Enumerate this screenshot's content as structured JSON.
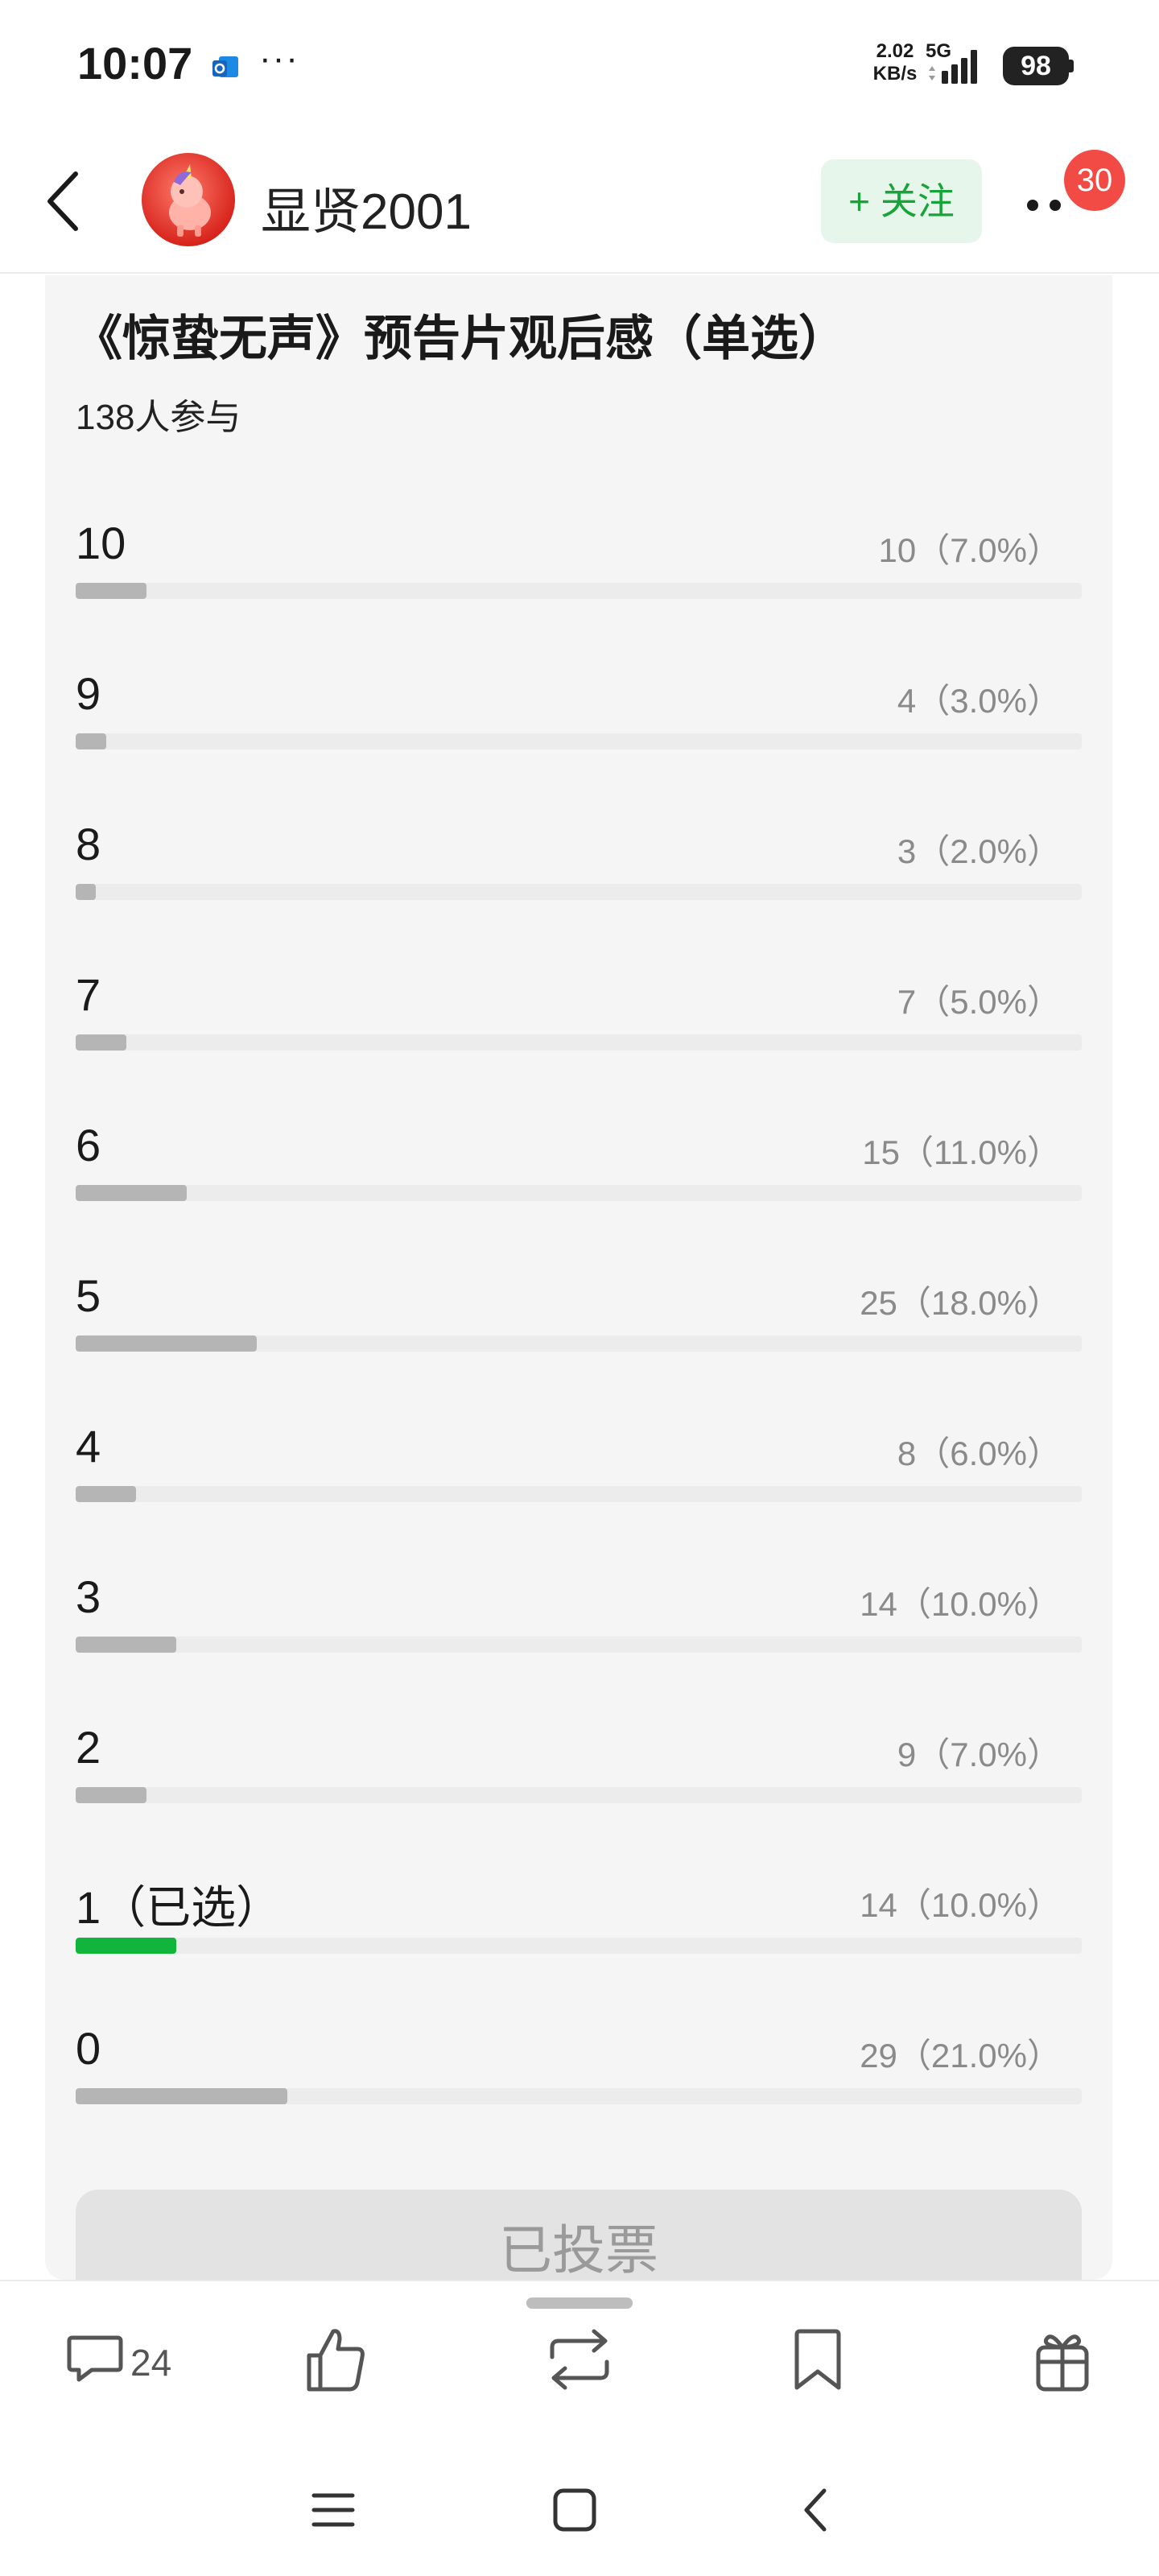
{
  "status_bar": {
    "time": "10:07",
    "app_icon": "outlook-icon",
    "overflow": "···",
    "net_speed_value": "2.02",
    "net_speed_unit": "KB/s",
    "network": "5G",
    "battery": "98"
  },
  "header": {
    "back_icon": "chevron-left-icon",
    "user_name": "显贤2001",
    "follow_label": "+ 关注",
    "notification_count": "30"
  },
  "poll": {
    "title": "《惊蛰无声》预告片观后感（单选）",
    "participants": "138人参与",
    "options": [
      {
        "label": "10",
        "stat": "10（7.0%）",
        "percent": 7.0,
        "selected": false
      },
      {
        "label": "9",
        "stat": "4（3.0%）",
        "percent": 3.0,
        "selected": false
      },
      {
        "label": "8",
        "stat": "3（2.0%）",
        "percent": 2.0,
        "selected": false
      },
      {
        "label": "7",
        "stat": "7（5.0%）",
        "percent": 5.0,
        "selected": false
      },
      {
        "label": "6",
        "stat": "15（11.0%）",
        "percent": 11.0,
        "selected": false
      },
      {
        "label": "5",
        "stat": "25（18.0%）",
        "percent": 18.0,
        "selected": false
      },
      {
        "label": "4",
        "stat": "8（6.0%）",
        "percent": 6.0,
        "selected": false
      },
      {
        "label": "3",
        "stat": "14（10.0%）",
        "percent": 10.0,
        "selected": false
      },
      {
        "label": "2",
        "stat": "9（7.0%）",
        "percent": 7.0,
        "selected": false
      },
      {
        "label": "1（已选）",
        "stat": "14（10.0%）",
        "percent": 10.0,
        "selected": true
      },
      {
        "label": "0",
        "stat": "29（21.0%）",
        "percent": 21.0,
        "selected": false
      }
    ],
    "voted_label": "已投票"
  },
  "actions": {
    "comment_count": "24",
    "icons": [
      "comment-icon",
      "like-icon",
      "repost-icon",
      "bookmark-icon",
      "gift-icon"
    ]
  },
  "colors": {
    "follow_bg": "#e6f6ea",
    "follow_text": "#19a33a",
    "selected_bar": "#12b53c",
    "bar": "#b5b5b5",
    "badge": "#f24b45"
  }
}
